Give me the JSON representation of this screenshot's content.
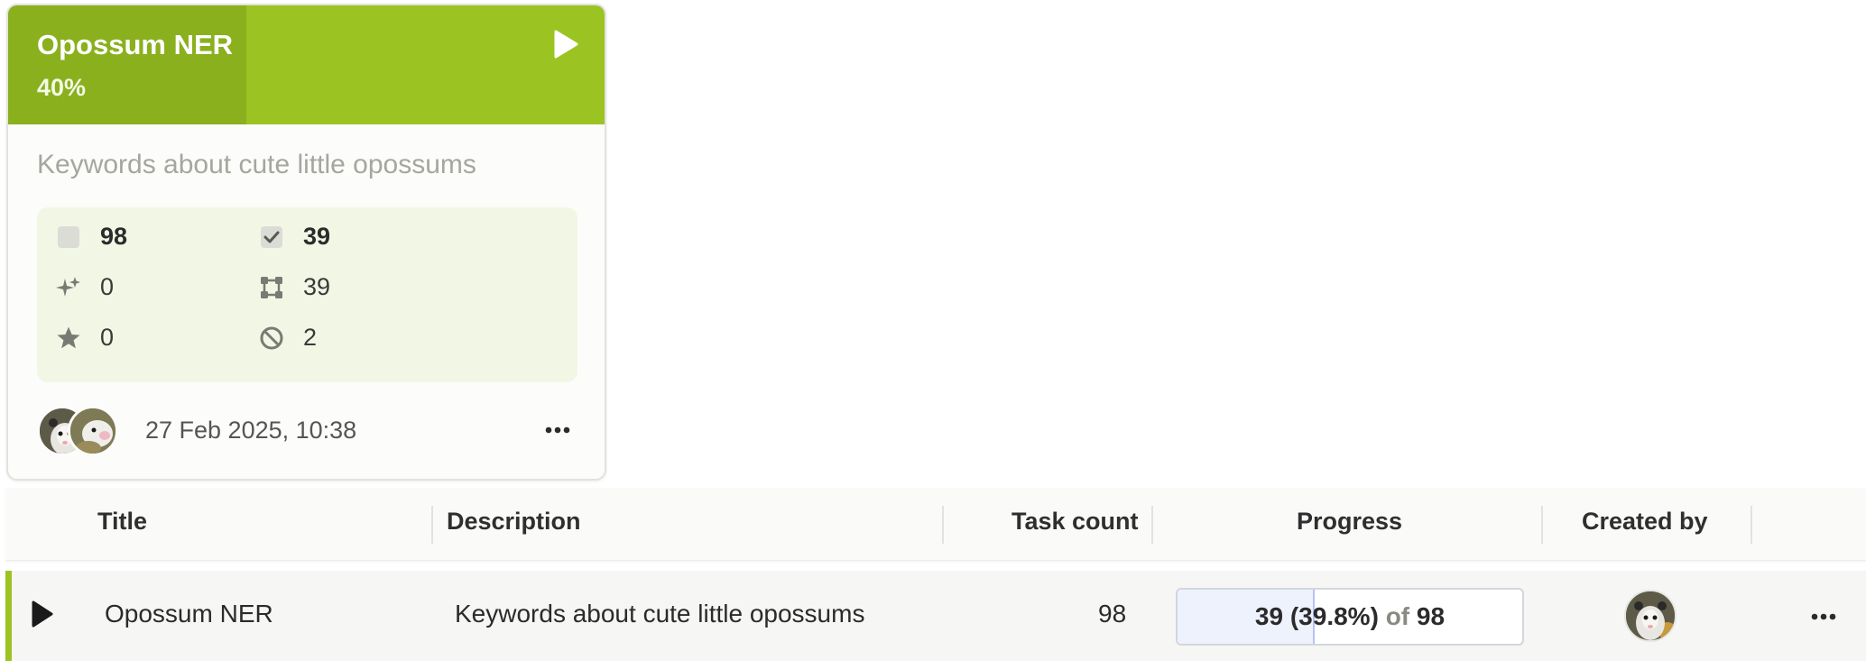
{
  "card": {
    "title": "Opossum NER",
    "progress_label": "40%",
    "progress_fraction": 0.4,
    "description": "Keywords about cute little opossums",
    "stats": {
      "tasks": "98",
      "completed": "39",
      "predictions": "0",
      "annotations": "39",
      "starred": "0",
      "skipped": "2"
    },
    "date": "27 Feb 2025, 10:38",
    "icons": {
      "play": "play-icon",
      "tasks": "checkbox-empty-icon",
      "completed": "checkbox-checked-icon",
      "predictions": "sparkles-icon",
      "annotations": "bounding-box-icon",
      "starred": "star-icon",
      "skipped": "ban-icon",
      "more": "ellipsis-icon"
    }
  },
  "table": {
    "headers": {
      "title": "Title",
      "description": "Description",
      "task_count": "Task count",
      "progress": "Progress",
      "created_by": "Created by"
    },
    "rows": [
      {
        "title": "Opossum NER",
        "description": "Keywords about cute little opossums",
        "task_count": "98",
        "progress_done": "39",
        "progress_pct": "(39.8%)",
        "progress_of": "of",
        "progress_total": "98",
        "progress_fraction": 0.398
      }
    ]
  },
  "colors": {
    "brand_green": "#9bc423",
    "brand_green_dark": "#8ab01e",
    "stats_bg": "#f1f7e4",
    "progress_fill": "#eef2fd"
  }
}
